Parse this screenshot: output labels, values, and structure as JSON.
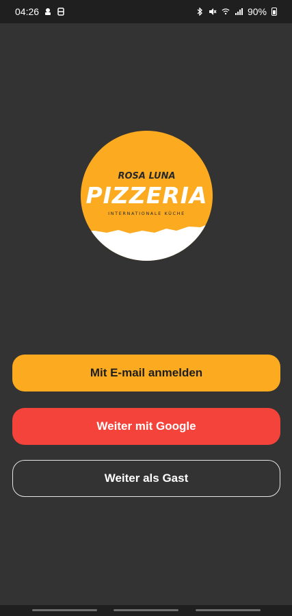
{
  "status_bar": {
    "time": "04:26",
    "battery": "90%",
    "icons": [
      "notification-icon",
      "b-icon",
      "bluetooth-icon",
      "mute-icon",
      "wifi-icon",
      "signal-icon",
      "battery-icon"
    ]
  },
  "logo": {
    "line1": "ROSA LUNA",
    "line2": "PIZZERIA",
    "line3": "INTERNATIONALE KÜCHE",
    "accent_color": "#fcab20"
  },
  "buttons": {
    "email": "Mit E-mail anmelden",
    "google": "Weiter mit Google",
    "guest": "Weiter als Gast"
  },
  "colors": {
    "background": "#333333",
    "email_button": "#fcab20",
    "google_button": "#f4433b"
  }
}
